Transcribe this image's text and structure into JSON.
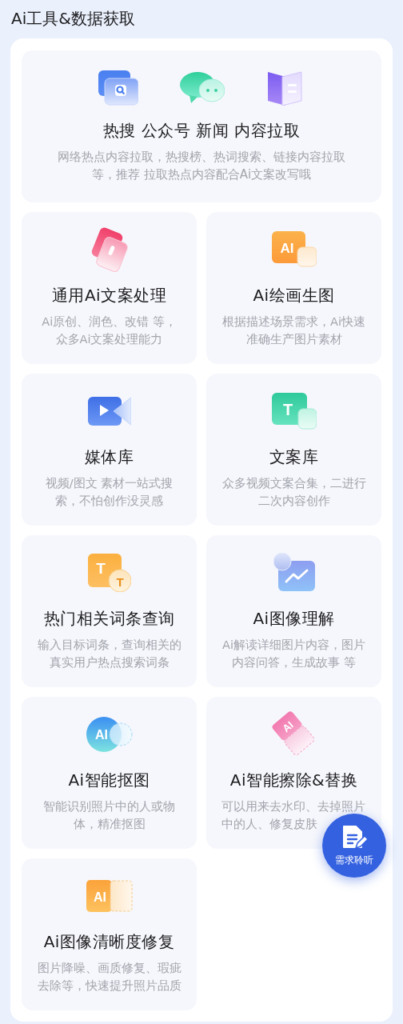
{
  "heading": "Ai工具&数据获取",
  "featured": {
    "title": "热搜 公众号 新闻 内容拉取",
    "description": "网络热点内容拉取，热搜榜、热词搜索、链接内容拉取等，推荐 拉取热点内容配合Ai文案改写哦"
  },
  "tools": [
    {
      "title": "通用Ai文案处理",
      "description": "Ai原创、润色、改错 等，众多Ai文案处理能力"
    },
    {
      "title": "Ai绘画生图",
      "description": "根据描述场景需求，Ai快速准确生产图片素材",
      "icon_text": [
        "AI"
      ]
    },
    {
      "title": "媒体库",
      "description": "视频/图文 素材一站式搜索，不怕创作没灵感"
    },
    {
      "title": "文案库",
      "description": "众多视频文案合集，二进行二次内容创作",
      "icon_text": [
        "T"
      ]
    },
    {
      "title": "热门相关词条查询",
      "description": "输入目标词条，查询相关的真实用户热点搜索词条",
      "icon_text": [
        "T",
        "T"
      ]
    },
    {
      "title": "Ai图像理解",
      "description": "Ai解读详细图片内容，图片内容问答，生成故事 等"
    },
    {
      "title": "Ai智能抠图",
      "description": "智能识别照片中的人或物体，精准抠图",
      "icon_text": [
        "AI"
      ]
    },
    {
      "title": "Ai智能擦除&替换",
      "description": "可以用来去水印、去掉照片中的人、修复皮肤",
      "icon_text": [
        "AI"
      ]
    },
    {
      "title": "Ai图像清晰度修复",
      "description": "图片降噪、画质修复、瑕疵去除等，快速提升照片品质",
      "icon_text": [
        "AI"
      ]
    }
  ],
  "fab": {
    "label": "需求聆听"
  }
}
